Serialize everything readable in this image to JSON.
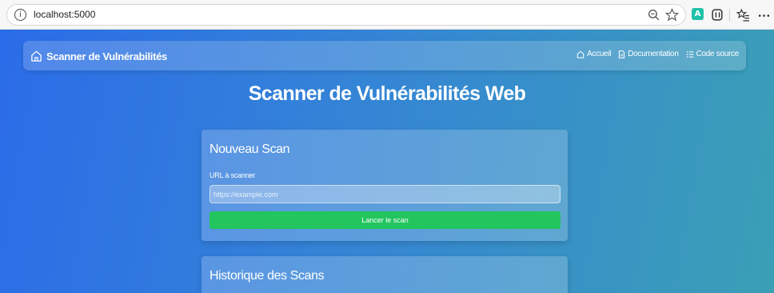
{
  "browser": {
    "url": "localhost:5000",
    "icons": [
      "info-icon",
      "zoom-icon",
      "favorite-star-icon",
      "extension-icon",
      "copilot-icon",
      "favorites-bar-icon",
      "more-icon"
    ]
  },
  "navbar": {
    "brand": "Scanner de Vulnérabilités",
    "links": [
      {
        "label": "Accueil",
        "icon": "home-icon"
      },
      {
        "label": "Documentation",
        "icon": "document-icon"
      },
      {
        "label": "Code source",
        "icon": "list-icon"
      }
    ]
  },
  "main": {
    "title": "Scanner de Vulnérabilités Web"
  },
  "scan_card": {
    "title": "Nouveau Scan",
    "url_label": "URL à scanner",
    "url_placeholder": "https://example.com",
    "url_value": "",
    "button_label": "Lancer le scan"
  },
  "history_card": {
    "title": "Historique des Scans"
  },
  "colors": {
    "gradient_start": "#2b6ce8",
    "gradient_end": "#3b9fb6",
    "button": "#22c55e"
  }
}
